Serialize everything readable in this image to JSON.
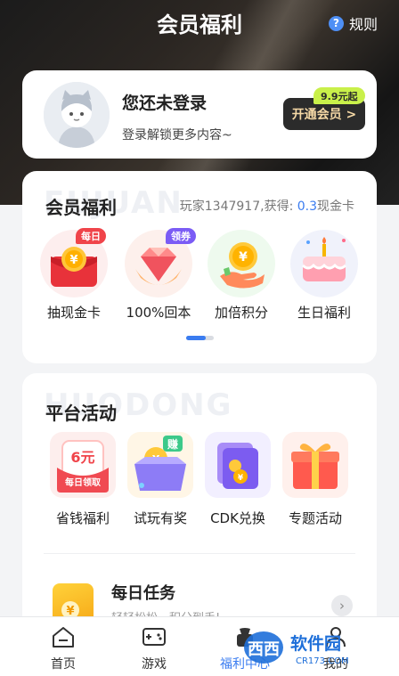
{
  "header": {
    "title": "会员福利",
    "rules_label": "规则",
    "rules_icon": "help-circle-icon"
  },
  "login": {
    "title": "您还未登录",
    "subtitle": "登录解锁更多内容~",
    "vip_button": "开通会员 >",
    "vip_price_tag": "9.9元起"
  },
  "benefits": {
    "title": "会员福利",
    "watermark": "FUJUAN",
    "stat_prefix": "玩家1347917,获得: ",
    "stat_value": "0.3",
    "stat_suffix": "现金卡",
    "items": [
      {
        "label": "抽现金卡",
        "badge": "每日",
        "icon": "red-envelope-coin-icon"
      },
      {
        "label": "100%回本",
        "badge": "领券",
        "icon": "diamond-icon"
      },
      {
        "label": "加倍积分",
        "badge": "",
        "icon": "coin-hand-icon"
      },
      {
        "label": "生日福利",
        "badge": "",
        "icon": "birthday-cake-icon"
      }
    ]
  },
  "platform": {
    "title": "平台活动",
    "watermark": "HUODONG",
    "items": [
      {
        "label": "省钱福利",
        "icon_text": "6元",
        "icon_sub": "每日领取",
        "icon": "coupon-envelope-icon"
      },
      {
        "label": "试玩有奖",
        "icon_text": "赚",
        "icon": "coin-box-icon"
      },
      {
        "label": "CDK兑换",
        "icon": "purple-wallet-icon"
      },
      {
        "label": "专题活动",
        "icon": "gift-box-icon"
      }
    ],
    "daily_task": {
      "title": "每日任务",
      "subtitle": "轻轻松松，积分到手!"
    }
  },
  "tabbar": {
    "items": [
      {
        "label": "首页",
        "icon": "home-icon"
      },
      {
        "label": "游戏",
        "icon": "gamepad-icon"
      },
      {
        "label": "福利中心",
        "icon": "gift-icon"
      },
      {
        "label": "我的",
        "icon": "profile-icon"
      }
    ],
    "active_index": 2
  },
  "watermark_logo": {
    "brand": "西西",
    "text": "软件园",
    "url": "CR173.COM"
  },
  "colors": {
    "accent": "#3a7cf0",
    "vip_gold": "#f6d9a6",
    "price_tag": "#c9f04a"
  }
}
